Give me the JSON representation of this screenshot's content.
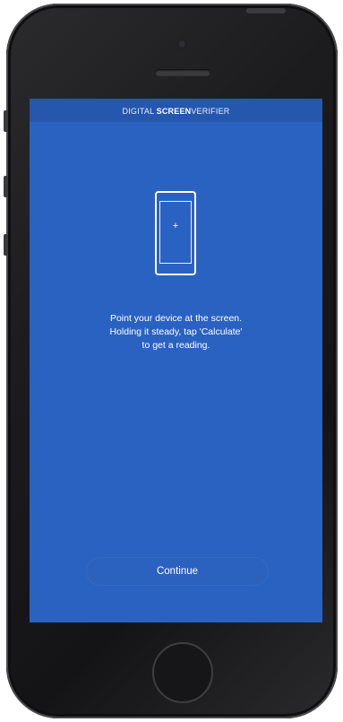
{
  "header": {
    "title_prefix": "DIGITAL ",
    "title_bold": "SCREEN",
    "title_suffix": "VERIFIER"
  },
  "main": {
    "device_icon_symbol": "+",
    "instructions": [
      "Point your device at the screen.",
      "Holding it steady, tap 'Calculate'",
      "to get a reading."
    ],
    "continue_label": "Continue"
  },
  "colors": {
    "screen_background": "#2a62c2",
    "titlebar_background": "#2457ad",
    "phone_body": "#1c1c1e"
  }
}
